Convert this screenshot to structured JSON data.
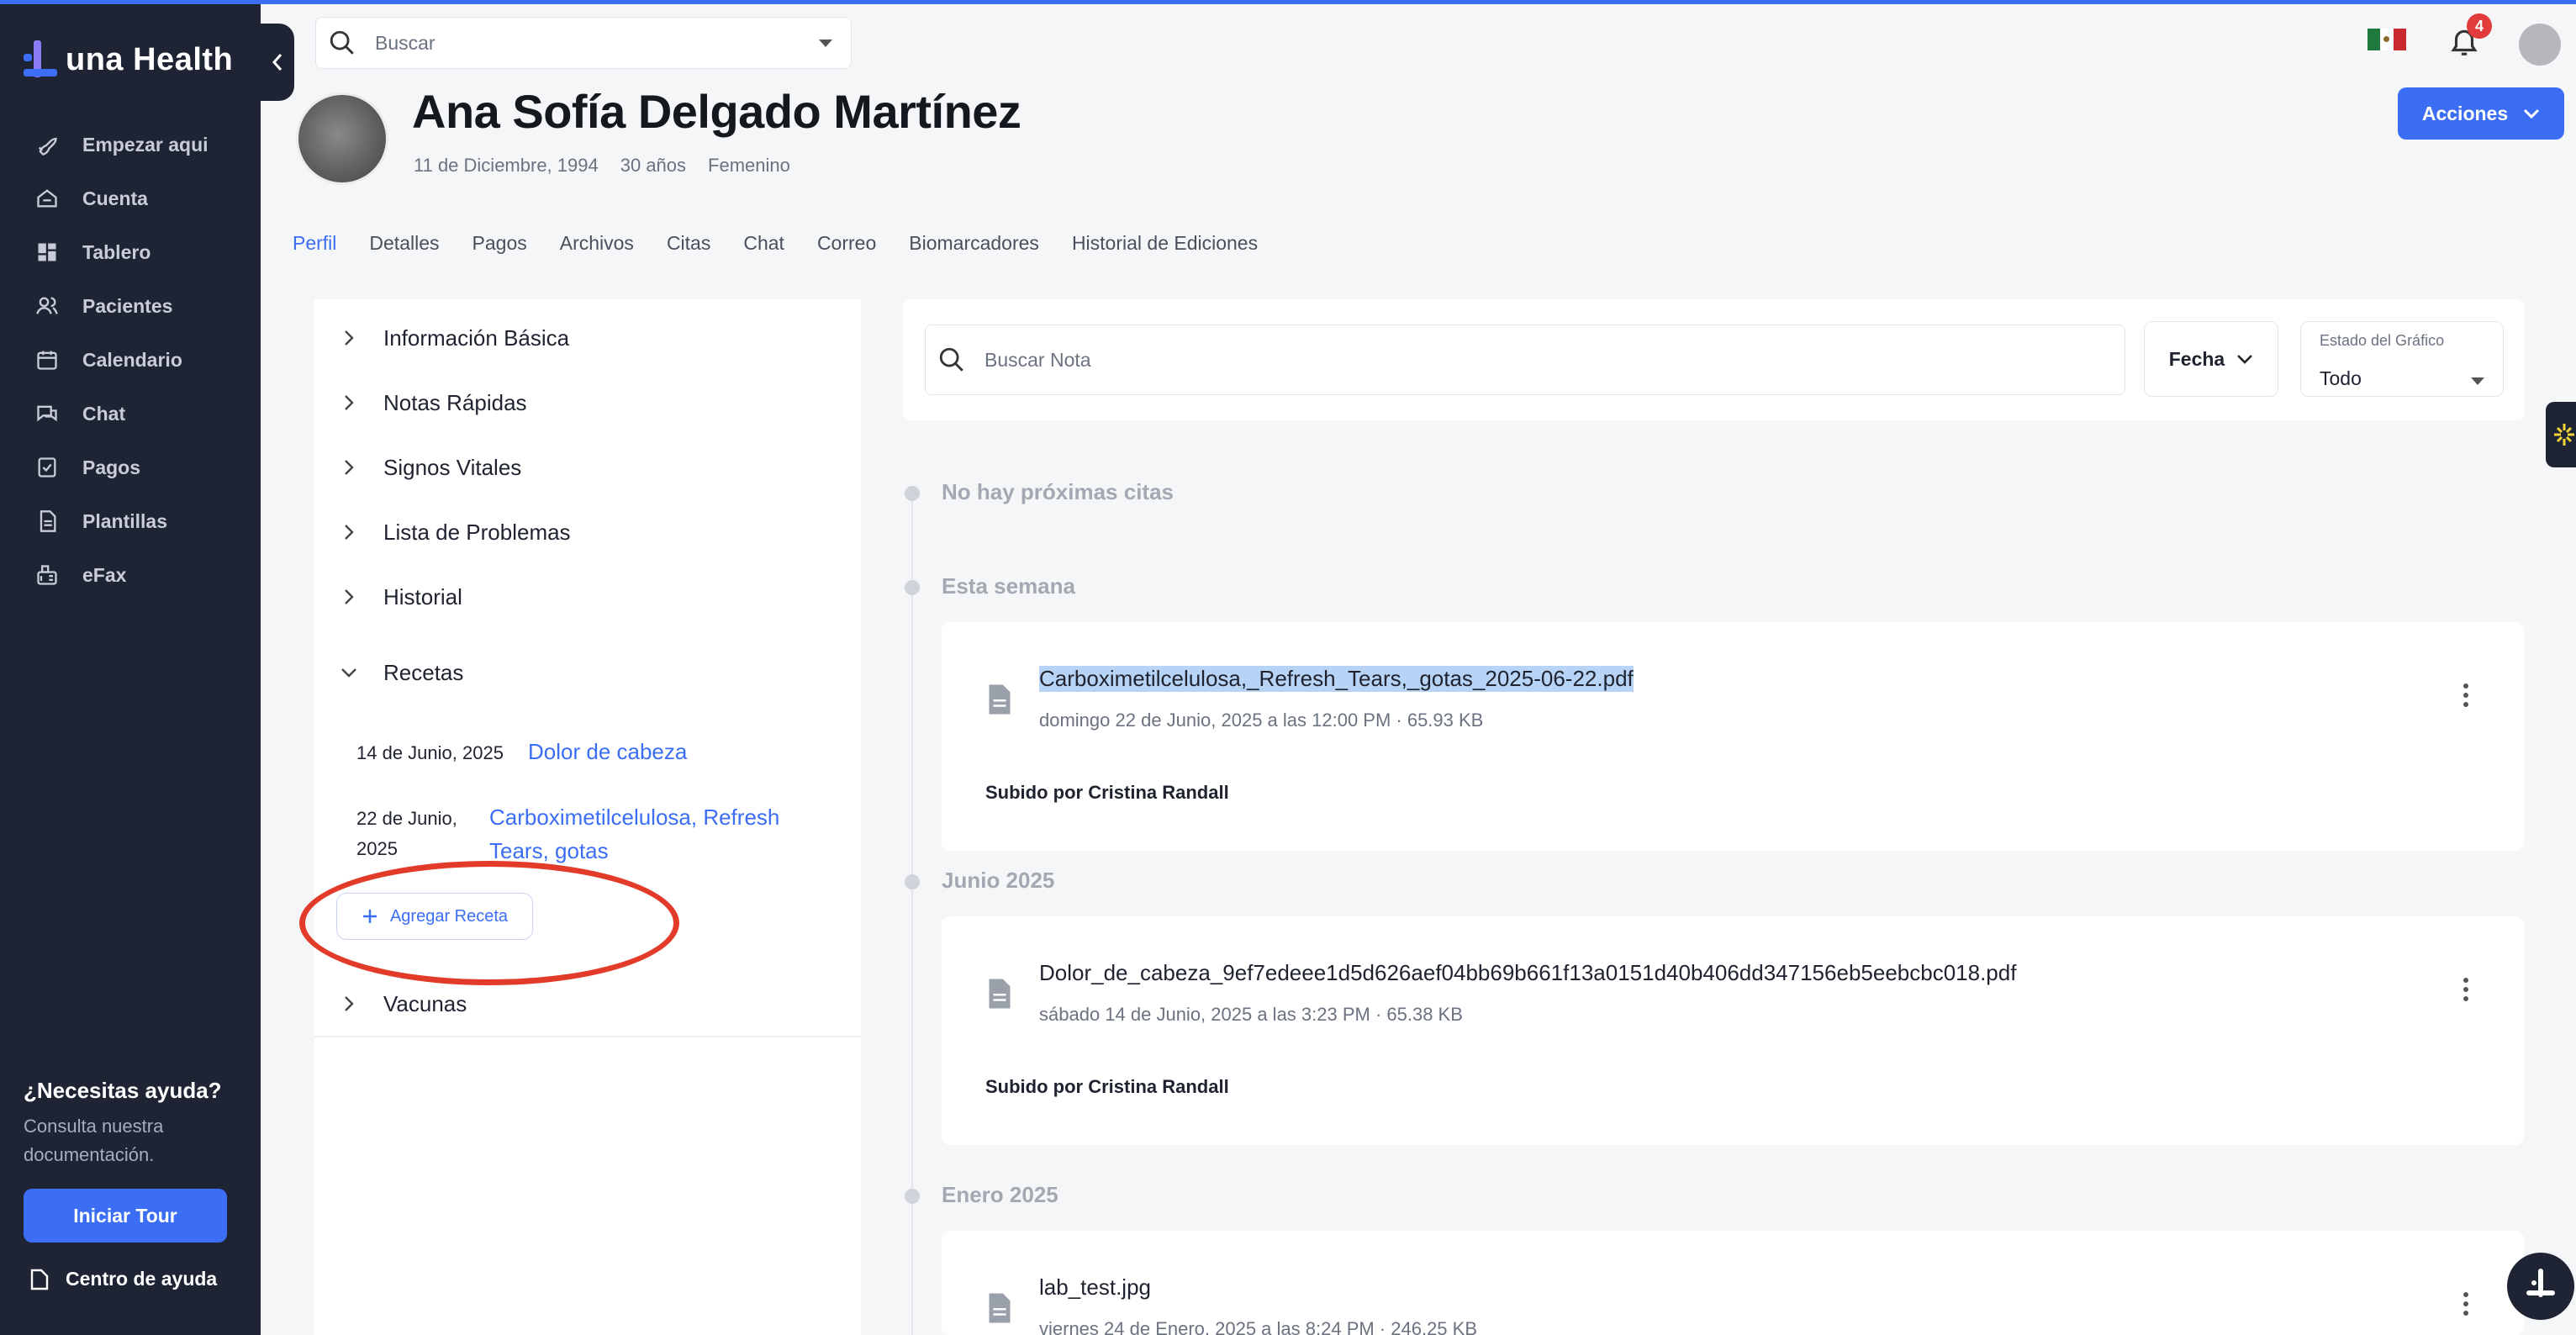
{
  "app": {
    "name": "una Health",
    "brand_color": "#3b6ef5",
    "sidebar_color": "#1e2433"
  },
  "sidebar": {
    "items": [
      {
        "label": "Empezar aqui",
        "icon": "rocket-icon"
      },
      {
        "label": "Cuenta",
        "icon": "home-icon"
      },
      {
        "label": "Tablero",
        "icon": "grid-icon"
      },
      {
        "label": "Pacientes",
        "icon": "users-icon"
      },
      {
        "label": "Calendario",
        "icon": "calendar-icon"
      },
      {
        "label": "Chat",
        "icon": "chat-icon"
      },
      {
        "label": "Pagos",
        "icon": "receipt-icon"
      },
      {
        "label": "Plantillas",
        "icon": "document-icon"
      },
      {
        "label": "eFax",
        "icon": "fax-icon"
      }
    ],
    "help_title": "¿Necesitas ayuda?",
    "help_subtitle": "Consulta nuestra documentación.",
    "tour_button": "Iniciar Tour",
    "help_center": "Centro de ayuda"
  },
  "header": {
    "search_placeholder": "Buscar",
    "notification_count": "4",
    "actions_button": "Acciones"
  },
  "patient": {
    "name": "Ana Sofía Delgado Martínez",
    "birthdate": "11 de Diciembre, 1994",
    "age": "30 años",
    "gender": "Femenino"
  },
  "tabs": [
    {
      "label": "Perfil",
      "active": true
    },
    {
      "label": "Detalles"
    },
    {
      "label": "Pagos"
    },
    {
      "label": "Archivos"
    },
    {
      "label": "Citas"
    },
    {
      "label": "Chat"
    },
    {
      "label": "Correo"
    },
    {
      "label": "Biomarcadores"
    },
    {
      "label": "Historial de Ediciones"
    }
  ],
  "left_panel": {
    "sections": [
      {
        "label": "Información Básica",
        "expanded": false
      },
      {
        "label": "Notas Rápidas",
        "expanded": false
      },
      {
        "label": "Signos Vitales",
        "expanded": false
      },
      {
        "label": "Lista de Problemas",
        "expanded": false
      },
      {
        "label": "Historial",
        "expanded": false
      },
      {
        "label": "Recetas",
        "expanded": true
      },
      {
        "label": "Vacunas",
        "expanded": false
      }
    ],
    "prescriptions": [
      {
        "date": "14 de Junio, 2025",
        "name": "Dolor de cabeza"
      },
      {
        "date_line1": "22 de Junio,",
        "date_line2": "2025",
        "name_line1": "Carboximetilcelulosa, Refresh",
        "name_line2": "Tears, gotas"
      }
    ],
    "add_prescription": "Agregar Receta"
  },
  "filters": {
    "note_search_placeholder": "Buscar Nota",
    "date_filter": "Fecha",
    "chart_status_label": "Estado del Gráfico",
    "chart_status_value": "Todo"
  },
  "timeline": {
    "groups": [
      {
        "label": "No hay próximas citas"
      },
      {
        "label": "Esta semana"
      },
      {
        "label": "Junio 2025"
      },
      {
        "label": "Enero 2025"
      }
    ],
    "files": [
      {
        "name": "Carboximetilcelulosa,_Refresh_Tears,_gotas_2025-06-22.pdf",
        "meta": "domingo 22 de Junio, 2025 a las 12:00 PM · 65.93 KB",
        "uploader": "Subido por Cristina Randall",
        "selected": true
      },
      {
        "name": "Dolor_de_cabeza_9ef7edeee1d5d626aef04bb69b661f13a0151d40b406dd347156eb5eebcbc018.pdf",
        "meta": "sábado 14 de Junio, 2025 a las 3:23 PM · 65.38 KB",
        "uploader": "Subido por Cristina Randall"
      },
      {
        "name": "lab_test.jpg",
        "meta": "viernes 24 de Enero, 2025 a las 8:24 PM · 246.25 KB"
      }
    ]
  }
}
